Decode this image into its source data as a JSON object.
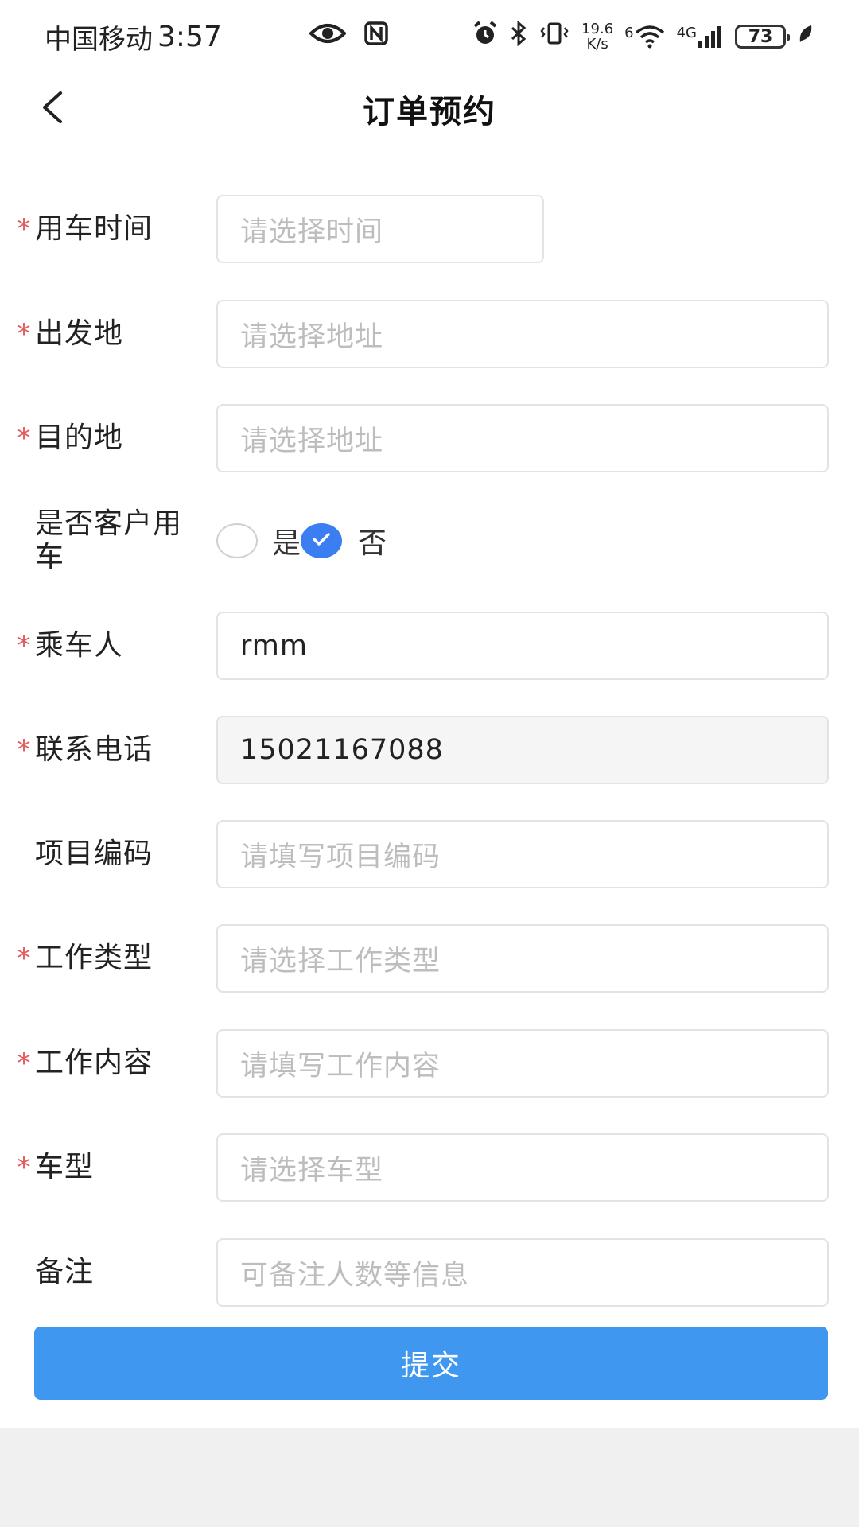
{
  "status_bar": {
    "carrier": "中国移动",
    "time": "3:57",
    "net_speed_value": "19.6",
    "net_speed_unit": "K/s",
    "wifi_badge": "6",
    "signal_badge": "4G",
    "battery": "73"
  },
  "header": {
    "title": "订单预约"
  },
  "form": {
    "rows": [
      {
        "label": "用车时间",
        "required": "*",
        "placeholder": "请选择时间",
        "value": ""
      },
      {
        "label": "出发地",
        "required": "*",
        "placeholder": "请选择地址",
        "value": ""
      },
      {
        "label": "目的地",
        "required": "*",
        "placeholder": "请选择地址",
        "value": ""
      },
      {
        "label": "是否客户用车",
        "required": "",
        "options": [
          "是",
          "否"
        ],
        "selected": "否"
      },
      {
        "label": "乘车人",
        "required": "*",
        "placeholder": "",
        "value": "rmm"
      },
      {
        "label": "联系电话",
        "required": "*",
        "placeholder": "",
        "value": "15021167088"
      },
      {
        "label": "项目编码",
        "required": "",
        "placeholder": "请填写项目编码",
        "value": ""
      },
      {
        "label": "工作类型",
        "required": "*",
        "placeholder": "请选择工作类型",
        "value": ""
      },
      {
        "label": "工作内容",
        "required": "*",
        "placeholder": "请填写工作内容",
        "value": ""
      },
      {
        "label": "车型",
        "required": "*",
        "placeholder": "请选择车型",
        "value": ""
      },
      {
        "label": "备注",
        "required": "",
        "placeholder": "可备注人数等信息",
        "value": ""
      }
    ]
  },
  "submit": {
    "label": "提交"
  },
  "colors": {
    "accent": "#3f97f0",
    "radio_checked": "#3a7ef2",
    "required": "#e35a5a",
    "placeholder": "#bdbdbd"
  }
}
